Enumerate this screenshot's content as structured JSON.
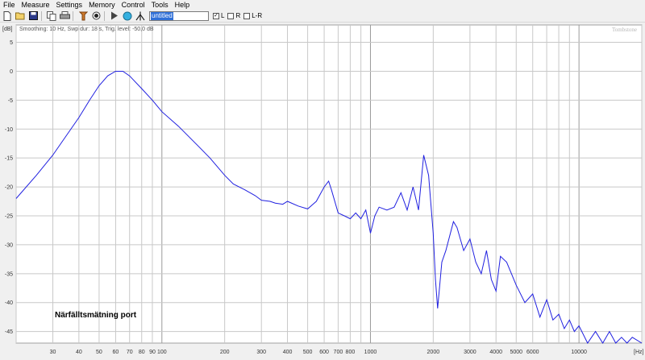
{
  "menu": [
    "File",
    "Measure",
    "Settings",
    "Memory",
    "Control",
    "Tools",
    "Help"
  ],
  "toolbar": {
    "buttons": [
      "new-file-icon",
      "open-folder-icon",
      "save-icon",
      "copy-icon",
      "print-icon",
      "tone-generator-icon",
      "record-icon",
      "play-icon",
      "loop-icon",
      "peak-icon"
    ],
    "title_value": "untitled",
    "channels": [
      {
        "label": "L",
        "checked": true
      },
      {
        "label": "R",
        "checked": false
      },
      {
        "label": "L-R",
        "checked": false
      }
    ]
  },
  "graph": {
    "info": "Smoothing: 10 Hz, Swp dur: 18 s, Trig. level: -50,0 dB",
    "brand": "Tombstone",
    "annotation": "Närfälltsmätning port",
    "ylabel": "[dB]",
    "xlabel": "[Hz]",
    "curve_color": "#2020e0",
    "y_ticks": [
      "5",
      "0",
      "-5",
      "-10",
      "-15",
      "-20",
      "-25",
      "-30",
      "-35",
      "-40",
      "-45"
    ],
    "x_ticks": [
      "30",
      "40",
      "50",
      "60",
      "70",
      "80",
      "90",
      "100",
      "200",
      "300",
      "400",
      "500",
      "600",
      "700",
      "800",
      "1000",
      "2000",
      "3000",
      "4000",
      "5000",
      "6000",
      "10000"
    ]
  },
  "chart_data": {
    "type": "line",
    "xscale": "log",
    "xlim": [
      20,
      20000
    ],
    "ylim": [
      -47,
      8
    ],
    "xlabel": "[Hz]",
    "ylabel": "[dB]",
    "grid": true,
    "series": [
      {
        "x": [
          20,
          25,
          30,
          35,
          40,
          45,
          50,
          55,
          60,
          65,
          70,
          80,
          90,
          100,
          120,
          150,
          170,
          200,
          220,
          250,
          280,
          300,
          330,
          350,
          380,
          400,
          450,
          500,
          550,
          600,
          630,
          650,
          700,
          750,
          800,
          850,
          900,
          950,
          1000,
          1050,
          1100,
          1200,
          1300,
          1400,
          1500,
          1600,
          1700,
          1800,
          1900,
          2000,
          2050,
          2100,
          2200,
          2300,
          2500,
          2600,
          2800,
          3000,
          3200,
          3400,
          3600,
          3800,
          4000,
          4200,
          4500,
          5000,
          5500,
          6000,
          6500,
          7000,
          7500,
          8000,
          8500,
          9000,
          9500,
          10000,
          11000,
          12000,
          13000,
          14000,
          15000,
          16000,
          17000,
          18000,
          20000
        ],
        "y": [
          -22,
          -18,
          -14.5,
          -11,
          -8,
          -5,
          -2.5,
          -0.8,
          0,
          0,
          -0.8,
          -3,
          -5,
          -7,
          -9.5,
          -13,
          -15,
          -18,
          -19.5,
          -20.5,
          -21.5,
          -22.3,
          -22.5,
          -22.8,
          -23,
          -22.5,
          -23.3,
          -23.8,
          -22.5,
          -20,
          -19,
          -20.5,
          -24.5,
          -25,
          -25.5,
          -24.5,
          -25.5,
          -24,
          -28,
          -25,
          -23.5,
          -24,
          -23.5,
          -21,
          -24,
          -20,
          -24,
          -14.5,
          -18,
          -28,
          -36,
          -41,
          -33,
          -31,
          -26,
          -27,
          -31,
          -29,
          -33,
          -35,
          -31,
          -36,
          -38,
          -32,
          -33,
          -37,
          -40,
          -38.5,
          -42.5,
          -39.5,
          -43,
          -42,
          -44.5,
          -43,
          -45,
          -44,
          -47,
          -45,
          -47,
          -45,
          -47,
          -46,
          -47,
          -46,
          -47
        ]
      }
    ]
  }
}
